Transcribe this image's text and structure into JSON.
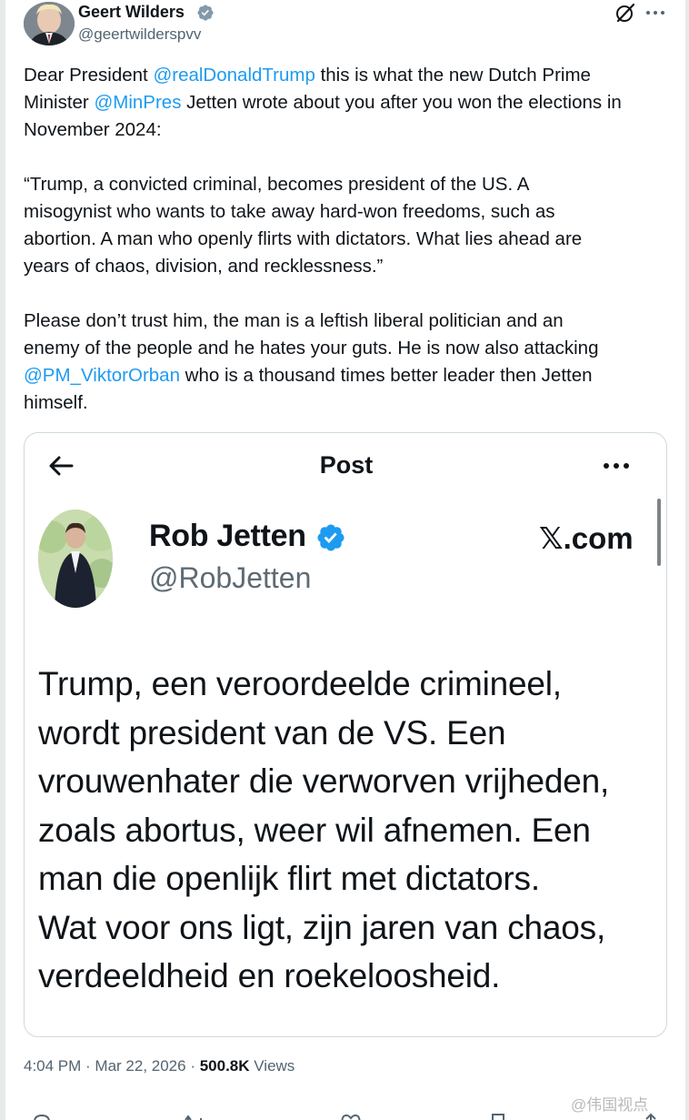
{
  "author": {
    "name": "Geert Wilders",
    "handle": "@geertwilderspvv"
  },
  "tweet": {
    "p1": [
      {
        "t": "Dear President ",
        "m": false
      },
      {
        "t": "@realDonaldTrump",
        "m": true
      },
      {
        "t": " this is what the new Dutch Prime",
        "m": false
      },
      {
        "br": true
      },
      {
        "t": "Minister ",
        "m": false
      },
      {
        "t": "@MinPres",
        "m": true
      },
      {
        "t": " Jetten wrote about you after you won the elections in",
        "m": false
      },
      {
        "br": true
      },
      {
        "t": "November 2024:",
        "m": false
      }
    ],
    "p2": [
      "“Trump, a convicted criminal, becomes president of the US. A",
      "misogynist who wants to take away hard-won freedoms, such as",
      "abortion. A man who openly flirts with dictators. What lies ahead are",
      "years of chaos, division, and recklessness.”"
    ],
    "p3": [
      {
        "t": "Please don’t trust him, the man is a leftish liberal politician and an",
        "m": false
      },
      {
        "br": true
      },
      {
        "t": "enemy of the people and he hates your guts. He is now also attacking",
        "m": false
      },
      {
        "br": true
      },
      {
        "t": "@PM_ViktorOrban",
        "m": true
      },
      {
        "t": " who is a thousand times better leader then Jetten",
        "m": false
      },
      {
        "br": true
      },
      {
        "t": "himself.",
        "m": false
      }
    ]
  },
  "card": {
    "title": "Post",
    "name": "Rob Jetten",
    "handle": "@RobJetten",
    "brand": "𝕏.com",
    "lines": [
      "Trump, een veroordeelde crimineel,",
      "wordt president van de VS. Een",
      "vrouwenhater die verworven vrijheden,",
      "zoals abortus, weer wil afnemen. Een",
      "man die openlijk flirt met dictators.",
      "Wat voor ons ligt, zijn jaren van chaos,",
      "verdeeldheid en roekeloosheid."
    ]
  },
  "meta": {
    "time": "4:04 PM",
    "sep1": " · ",
    "date": "Mar 22, 2026",
    "sep2": " · ",
    "views_count": "500.8K",
    "views_label": " Views"
  },
  "watermark": "@伟国视点",
  "colors": {
    "accent": "#1d9bf0",
    "text": "#0f1419",
    "muted": "#536471",
    "border": "#cfd9de"
  },
  "icons": [
    "verified-badge-icon",
    "grok-icon",
    "more-icon",
    "back-arrow-icon",
    "reply-icon",
    "repost-icon",
    "like-icon",
    "bookmark-icon",
    "share-icon"
  ]
}
